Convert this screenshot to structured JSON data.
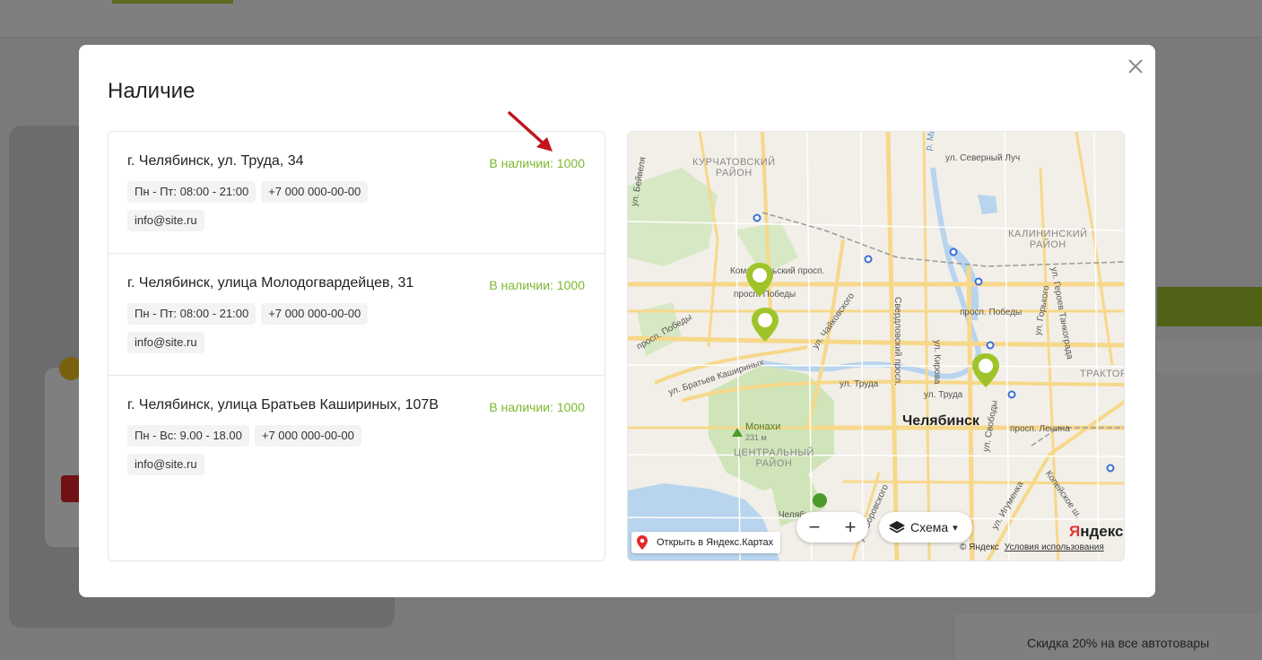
{
  "modal": {
    "title": "Наличие",
    "stores": [
      {
        "address": "г. Челябинск, ул. Труда, 34",
        "stock": "В наличии: 1000",
        "hours": "Пн - Пт: 08:00 - 21:00",
        "phone": "+7 000 000-00-00",
        "email": "info@site.ru"
      },
      {
        "address": "г. Челябинск, улица Молодогвардейцев, 31",
        "stock": "В наличии: 1000",
        "hours": "Пн - Пт: 08:00 - 21:00",
        "phone": "+7 000 000-00-00",
        "email": "info@site.ru"
      },
      {
        "address": "г. Челябинск, улица Братьев Кашириных, 107В",
        "stock": "В наличии: 1000",
        "hours": "Пн - Вс: 9.00 - 18.00",
        "phone": "+7 000 000-00-00",
        "email": "info@site.ru"
      }
    ]
  },
  "map": {
    "city": "Челябинск",
    "districts": {
      "kurchatovsky": "КУРЧАТОВСКИЙ\nРАЙОН",
      "kalininsky": "КАЛИНИНСКИЙ\nРАЙОН",
      "central": "ЦЕНТРАЛЬНЫЙ\nРАЙОН",
      "traktor": "ТРАКТОР"
    },
    "streets": {
      "s1": "ул. Северный Луч",
      "s2": "ул. Бейвеля",
      "s3": "Комсомольский просп.",
      "s4": "просп. Победы",
      "s5": "просп. Победы",
      "s6": "ул. Чайковского",
      "s7": "ул. Братьев Кашириных",
      "s8": "ул. Труда",
      "s9": "ул. Труда",
      "s10": "просп. Победы",
      "s11": "Свердловский просп.",
      "s12": "ул. Кирова",
      "s13": "ул. Свободы",
      "s14": "просп. Ленина",
      "s15": "ул. Горького",
      "s16": "ул. Героев Танкограда",
      "s17": "ул. Воровского",
      "s18": "ул. Игуменка",
      "s19": "Копейское ш.",
      "s20": "р. Миасс",
      "s21": "Челябинск"
    },
    "poi_monahi": "Монахи",
    "poi_monahi_height": "231 м",
    "zoom_out": "−",
    "zoom_in": "+",
    "layer_label": "Схема",
    "layer_caret": "▾",
    "open_link": "Открыть в Яндекс.Картах",
    "logo_first": "Я",
    "logo_rest": "ндекс",
    "copyright": "© Яндекс",
    "terms": "Условия использования"
  },
  "colors": {
    "accent_green": "#7cb82f",
    "pin_green": "#9fc42a",
    "arrow_red": "#c0151c"
  },
  "background": {
    "promo": "Скидка 20% на все автотовары"
  }
}
